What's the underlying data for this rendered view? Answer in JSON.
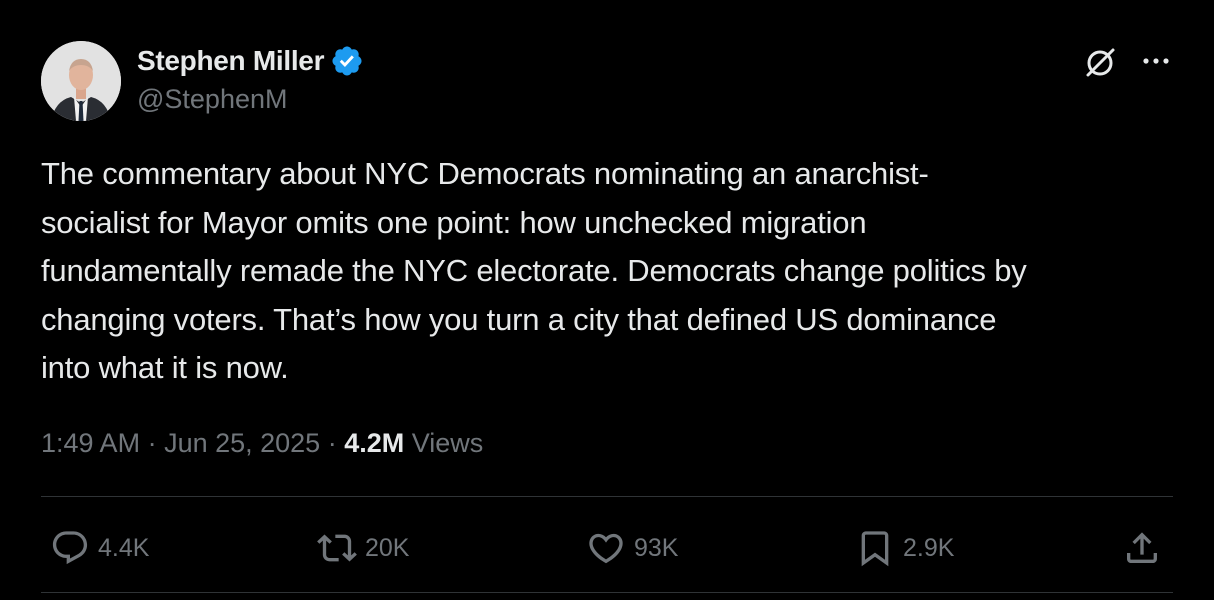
{
  "author": {
    "display_name": "Stephen Miller",
    "handle": "@StephenM",
    "verified": true,
    "verified_color": "#1d9bf0"
  },
  "header_icons": {
    "grok": "grok-icon",
    "more": "more-icon"
  },
  "tweet": {
    "text": "The commentary about NYC Democrats nominating an anarchist-\nsocialist for Mayor omits one point: how unchecked migration\nfundamentally remade the NYC electorate. Democrats change politics by\nchanging voters. That’s how you turn a city that defined US dominance\ninto what it is now."
  },
  "meta": {
    "time": "1:49 AM",
    "separator": " · ",
    "date": "Jun 25, 2025",
    "views_count": "4.2M",
    "views_label": " Views"
  },
  "actions": {
    "reply": {
      "icon": "reply-icon",
      "count": "4.4K"
    },
    "repost": {
      "icon": "repost-icon",
      "count": "20K"
    },
    "like": {
      "icon": "heart-icon",
      "count": "93K"
    },
    "bookmark": {
      "icon": "bookmark-icon",
      "count": "2.9K"
    },
    "share": {
      "icon": "share-icon"
    }
  },
  "colors": {
    "background": "#000000",
    "text_primary": "#e7e9ea",
    "text_secondary": "#71767b",
    "divider": "#2f3336"
  }
}
